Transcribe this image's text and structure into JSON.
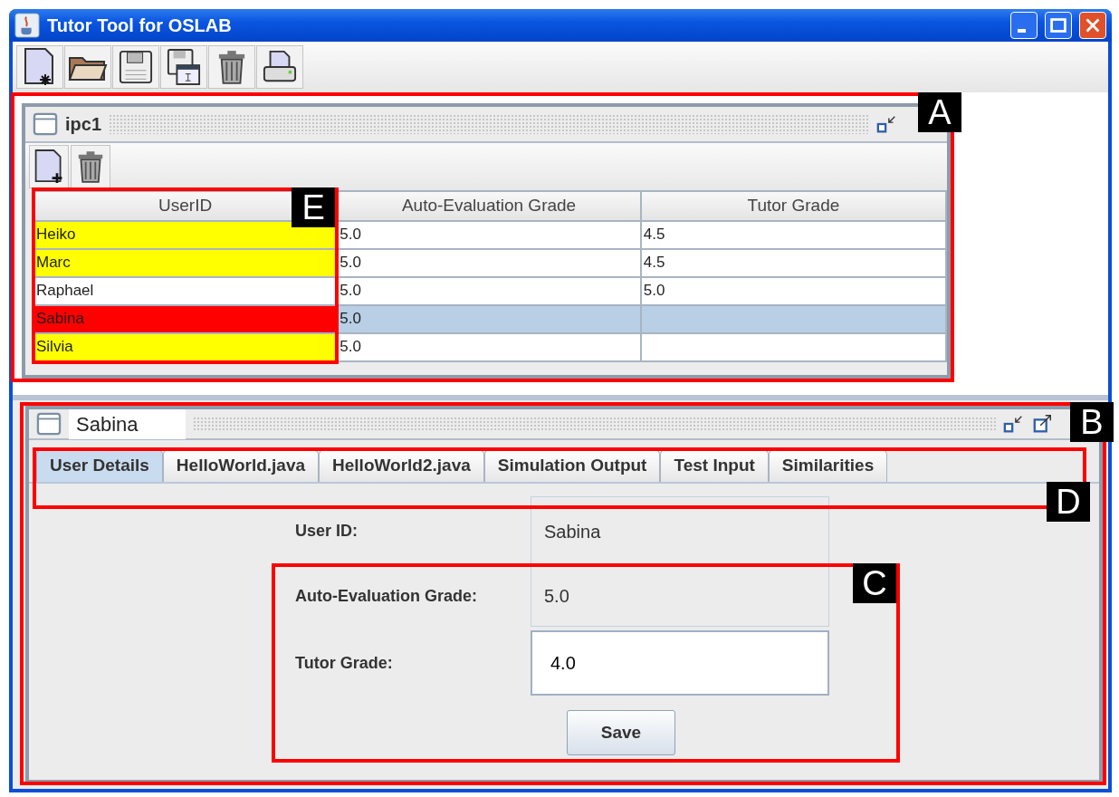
{
  "window": {
    "title": "Tutor Tool for OSLAB"
  },
  "list_frame": {
    "title": "ipc1",
    "table": {
      "columns": [
        "UserID",
        "Auto-Evaluation Grade",
        "Tutor Grade"
      ],
      "rows": [
        {
          "cells": [
            "Heiko",
            "5.0",
            "4.5"
          ],
          "color": "#ffff00",
          "selected": false
        },
        {
          "cells": [
            "Marc",
            "5.0",
            "4.5"
          ],
          "color": "#ffff00",
          "selected": false
        },
        {
          "cells": [
            "Raphael",
            "5.0",
            "5.0"
          ],
          "color": "#ffffff",
          "selected": false
        },
        {
          "cells": [
            "Sabina",
            "5.0",
            ""
          ],
          "color": "#ff0000",
          "selected": true
        },
        {
          "cells": [
            "Silvia",
            "5.0",
            ""
          ],
          "color": "#ffff00",
          "selected": false
        }
      ]
    }
  },
  "detail_frame": {
    "title": "Sabina",
    "tabs": [
      {
        "label": "User Details",
        "selected": true
      },
      {
        "label": "HelloWorld.java",
        "selected": false
      },
      {
        "label": "HelloWorld2.java",
        "selected": false
      },
      {
        "label": "Simulation Output",
        "selected": false
      },
      {
        "label": "Test Input",
        "selected": false
      },
      {
        "label": "Similarities",
        "selected": false
      }
    ],
    "form": {
      "user_id_label": "User ID:",
      "user_id": "Sabina",
      "auto_label": "Auto-Evaluation Grade:",
      "auto_value": "5.0",
      "tutor_label": "Tutor Grade:",
      "tutor_value": "4.0",
      "save": "Save"
    }
  },
  "annotations": [
    {
      "label": "A"
    },
    {
      "label": "E"
    },
    {
      "label": "B"
    },
    {
      "label": "D"
    },
    {
      "label": "C"
    }
  ]
}
